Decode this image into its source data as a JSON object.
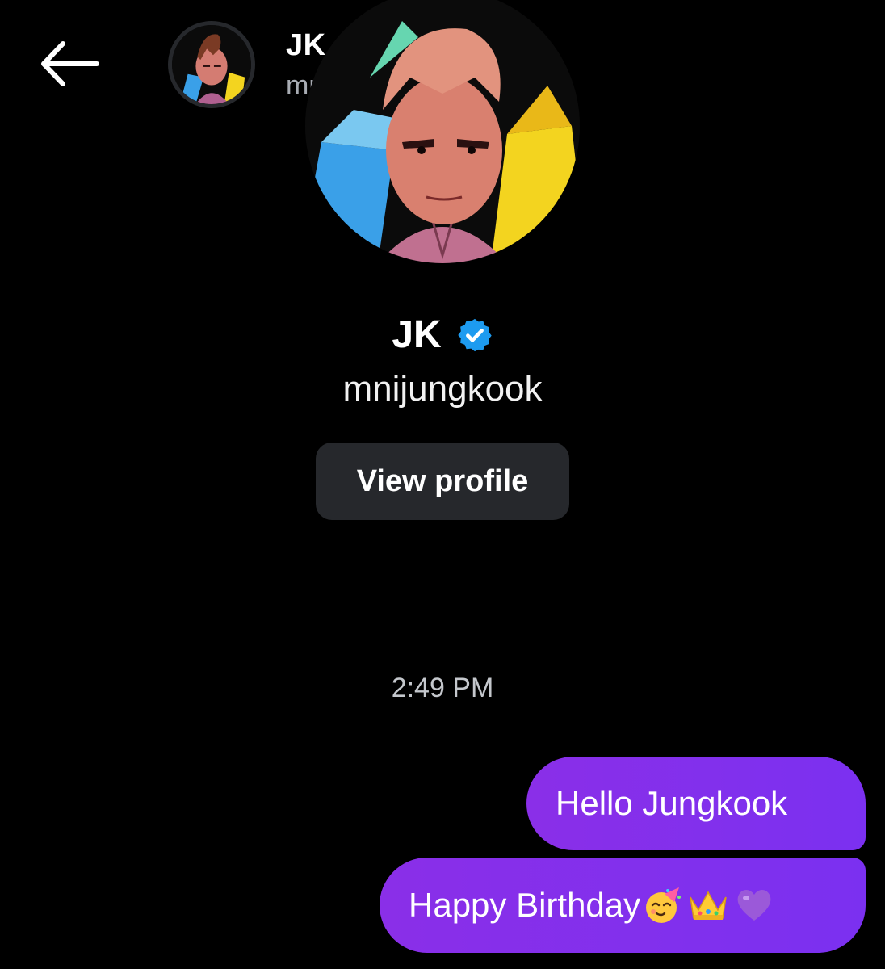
{
  "header": {
    "back_icon": "arrow-left-icon",
    "display_name": "JK",
    "handle": "mnijungkook",
    "verified_icon": "verified-badge-icon",
    "verified_color": "#1d9bf0"
  },
  "profile": {
    "display_name": "JK",
    "handle": "mnijungkook",
    "view_profile_label": "View profile"
  },
  "conversation": {
    "timestamp": "2:49 PM",
    "messages": [
      {
        "text": "Hello Jungkook",
        "emojis": []
      },
      {
        "text": "Happy Birthday",
        "emojis": [
          "partying-face-emoji",
          "crown-emoji",
          "purple-heart-emoji"
        ]
      }
    ],
    "bubble_color": "#8a2fe8"
  }
}
